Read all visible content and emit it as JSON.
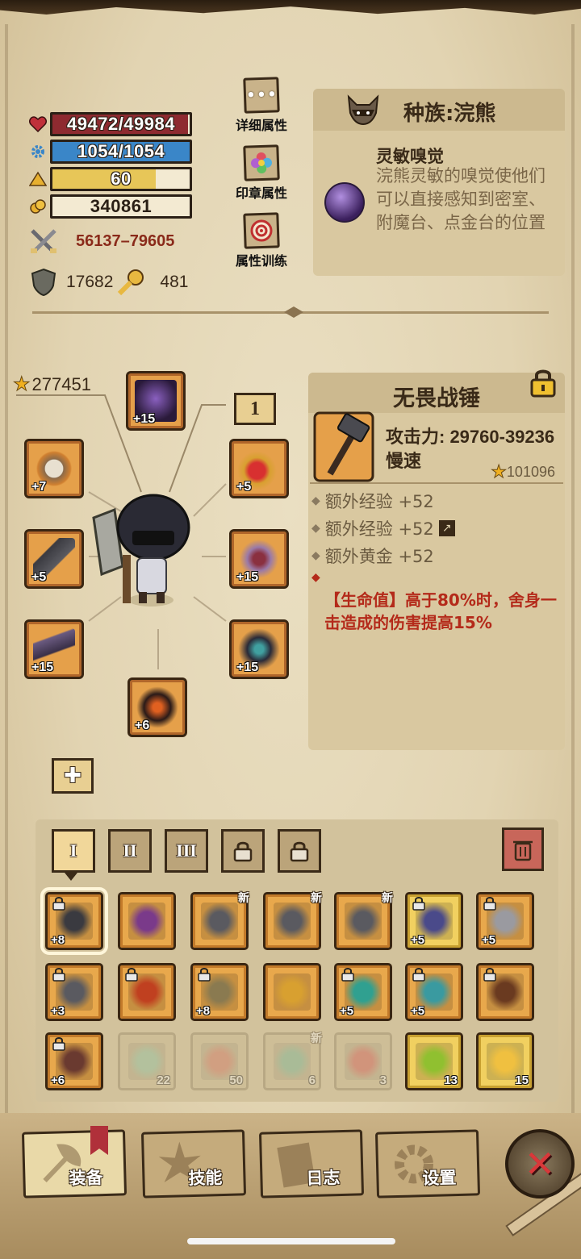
{
  "stats": {
    "hp": "49472/49984",
    "mp": "1054/1054",
    "level": "60",
    "gold": "340861",
    "hp_ratio": 0.99,
    "mp_ratio": 1.0,
    "level_ratio": 0.75,
    "attack": "56137–79605",
    "defense": "17682",
    "speed": "481",
    "icons": {
      "hp": "heart-icon",
      "mp": "gear-icon",
      "level": "triangle-icon",
      "gold": "coin-icon"
    }
  },
  "side_buttons": [
    {
      "label": "详细属性",
      "icon": "dots-icon"
    },
    {
      "label": "印章属性",
      "icon": "flower-seal-icon"
    },
    {
      "label": "属性训练",
      "icon": "target-icon"
    }
  ],
  "race": {
    "title": "种族:浣熊",
    "trait_name": "灵敏嗅觉",
    "trait_desc": "浣熊灵敏的嗅觉使他们可以直接感知到密室、附魔台、点金台的位置"
  },
  "equipment": {
    "score": "277451",
    "badge": "1",
    "slots": [
      {
        "id": "helmet",
        "level": "+15"
      },
      {
        "id": "ring",
        "level": "+7"
      },
      {
        "id": "amulet",
        "level": "+5"
      },
      {
        "id": "gloves",
        "level": "+5"
      },
      {
        "id": "shoulders",
        "level": "+15"
      },
      {
        "id": "weapon",
        "level": "+15"
      },
      {
        "id": "armor",
        "level": "+15"
      },
      {
        "id": "boots",
        "level": "+6"
      }
    ]
  },
  "item": {
    "name": "无畏战锤",
    "attack": "攻击力: 29760-39236",
    "speed": "慢速",
    "score": "101096",
    "affixes": [
      "额外经验 +52",
      "额外经验 +52",
      "额外黄金 +52"
    ],
    "special": "【生命值】高于80%时，舍身一击造成的伤害提高15%"
  },
  "inventory": {
    "tabs": [
      "I",
      "II",
      "III"
    ],
    "rows": [
      [
        {
          "lvl": "+8",
          "new": "",
          "cnt": ""
        },
        {
          "lvl": "",
          "new": "",
          "cnt": ""
        },
        {
          "lvl": "",
          "new": "新",
          "cnt": ""
        },
        {
          "lvl": "",
          "new": "新",
          "cnt": ""
        },
        {
          "lvl": "",
          "new": "新",
          "cnt": ""
        },
        {
          "lvl": "+5",
          "new": "",
          "cnt": ""
        },
        {
          "lvl": "+5",
          "new": "",
          "cnt": ""
        }
      ],
      [
        {
          "lvl": "+3",
          "new": "",
          "cnt": ""
        },
        {
          "lvl": "",
          "new": "",
          "cnt": ""
        },
        {
          "lvl": "+8",
          "new": "",
          "cnt": ""
        },
        {
          "lvl": "",
          "new": "",
          "cnt": ""
        },
        {
          "lvl": "+5",
          "new": "",
          "cnt": ""
        },
        {
          "lvl": "+5",
          "new": "",
          "cnt": ""
        },
        {
          "lvl": "",
          "new": "",
          "cnt": ""
        }
      ],
      [
        {
          "lvl": "+6",
          "new": "",
          "cnt": ""
        },
        {
          "lvl": "",
          "new": "",
          "cnt": "22"
        },
        {
          "lvl": "",
          "new": "",
          "cnt": "50"
        },
        {
          "lvl": "",
          "new": "新",
          "cnt": "6"
        },
        {
          "lvl": "",
          "new": "",
          "cnt": "3"
        },
        {
          "lvl": "",
          "new": "",
          "cnt": "13"
        },
        {
          "lvl": "",
          "new": "",
          "cnt": "15"
        }
      ]
    ]
  },
  "nav": {
    "equip": "装备",
    "skills": "技能",
    "journal": "日志",
    "settings": "设置"
  },
  "colors": {
    "hp_bar": "#8e2a30",
    "mp_bar": "#3a86c8",
    "level_bar": "#e7c658",
    "accent_red": "#b42a1a",
    "parchment": "#e2d4b2"
  }
}
